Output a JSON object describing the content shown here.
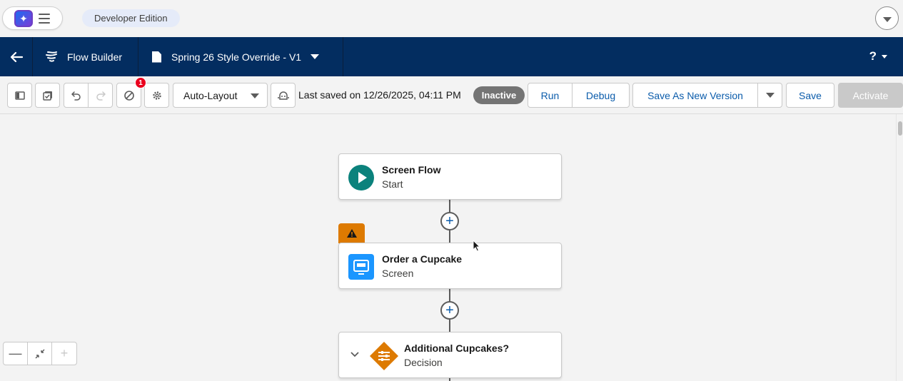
{
  "topbar": {
    "edition_label": "Developer Edition"
  },
  "navbar": {
    "app_name": "Flow Builder",
    "flow_title": "Spring 26 Style Override - V1",
    "help_label": "?"
  },
  "toolbar": {
    "warnings_count": "1",
    "layout_mode": "Auto-Layout",
    "last_saved": "Last saved on 12/26/2025, 04:11 PM",
    "status": "Inactive",
    "run_label": "Run",
    "debug_label": "Debug",
    "save_as_new_label": "Save As New Version",
    "save_label": "Save",
    "activate_label": "Activate"
  },
  "canvas": {
    "nodes": [
      {
        "title": "Screen Flow",
        "subtitle": "Start",
        "icon": "play-icon",
        "color": "#0b827c"
      },
      {
        "title": "Order a Cupcake",
        "subtitle": "Screen",
        "icon": "screen-icon",
        "color": "#1b96ff"
      },
      {
        "title": "Additional Cupcakes?",
        "subtitle": "Decision",
        "icon": "decision-icon",
        "color": "#dd7a01"
      }
    ],
    "add_glyph": "+",
    "warning_icon": "warning-icon"
  },
  "zoom": {
    "zoom_out_glyph": "—",
    "zoom_in_glyph": "+"
  },
  "colors": {
    "navy": "#032d60",
    "brand_blue": "#0b5cab",
    "badge_red": "#ea001e",
    "inactive_gray": "#747474"
  }
}
